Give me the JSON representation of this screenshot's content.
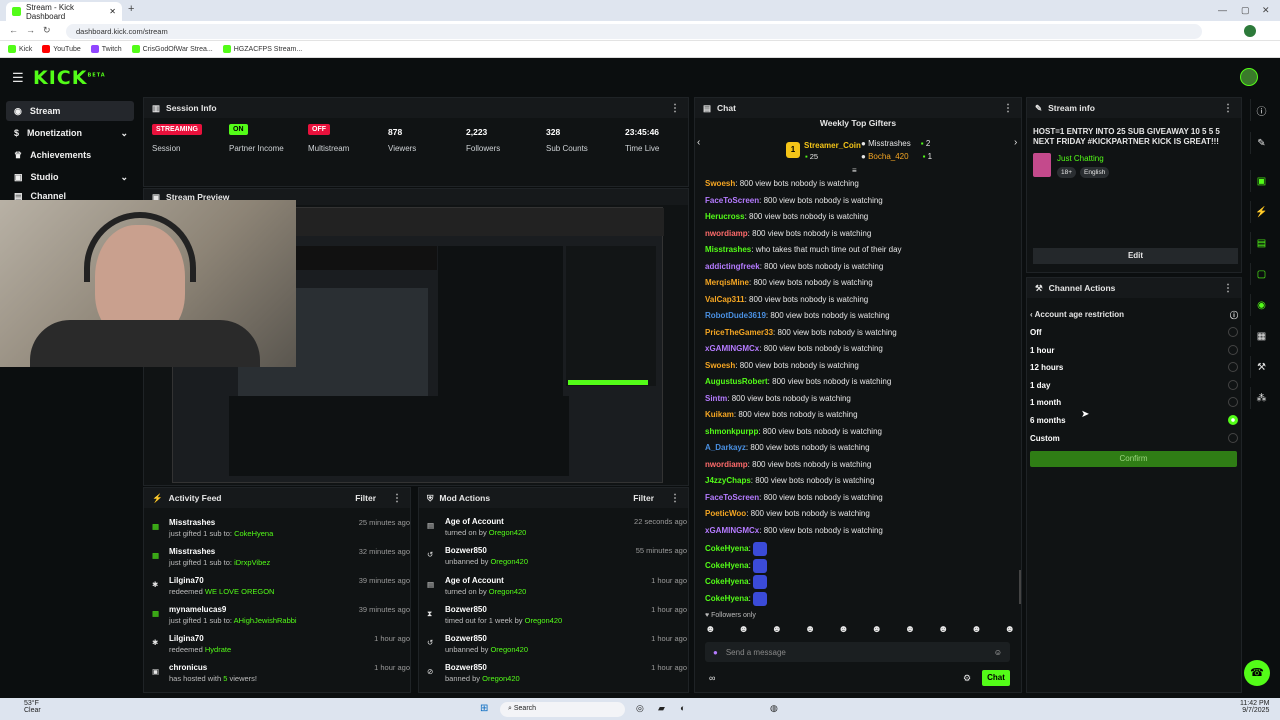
{
  "browser": {
    "tab_title": "Stream - Kick Dashboard",
    "url": "dashboard.kick.com/stream",
    "bookmarks": [
      "Kick",
      "YouTube",
      "Twitch",
      "CrisGodOfWar Strea...",
      "HGZACFPS Stream..."
    ]
  },
  "app": {
    "logo": "KICK",
    "beta": "BETA"
  },
  "sidebar": {
    "items": [
      {
        "label": "Stream",
        "icon": "signal-icon"
      },
      {
        "label": "Monetization",
        "icon": "dollar-icon"
      },
      {
        "label": "Achievements",
        "icon": "trophy-icon"
      },
      {
        "label": "Studio",
        "icon": "studio-icon"
      },
      {
        "label": "Channel",
        "icon": "channel-icon"
      }
    ]
  },
  "session": {
    "title": "Session Info",
    "stats": [
      {
        "badge": "STREAMING",
        "label": "Session"
      },
      {
        "badge": "ON",
        "label": "Partner Income"
      },
      {
        "badge": "OFF",
        "label": "Multistream"
      },
      {
        "value": "878",
        "label": "Viewers"
      },
      {
        "value": "2,223",
        "label": "Followers"
      },
      {
        "value": "328",
        "label": "Sub Counts"
      },
      {
        "value": "23:45:46",
        "label": "Time Live"
      }
    ]
  },
  "preview": {
    "title": "Stream Preview"
  },
  "activity": {
    "title": "Activity Feed",
    "filter": "Filter",
    "items": [
      {
        "name": "Misstrashes",
        "time": "25 minutes ago",
        "pre": "just gifted 1 sub to:",
        "hl": "CokeHyena"
      },
      {
        "name": "Misstrashes",
        "time": "32 minutes ago",
        "pre": "just gifted 1 sub to:",
        "hl": "iDrxpVibez"
      },
      {
        "name": "Lilgina70",
        "time": "39 minutes ago",
        "pre": "redeemed",
        "hl": "WE LOVE OREGON"
      },
      {
        "name": "mynamelucas9",
        "time": "39 minutes ago",
        "pre": "just gifted 1 sub to:",
        "hl": "AHighJewishRabbi"
      },
      {
        "name": "Lilgina70",
        "time": "1 hour ago",
        "pre": "redeemed",
        "hl": "Hydrate"
      },
      {
        "name": "chronicus",
        "time": "1 hour ago",
        "pre": "has hosted with",
        "hl": "5",
        "post": "viewers!"
      }
    ]
  },
  "modactions": {
    "title": "Mod Actions",
    "filter": "Filter",
    "items": [
      {
        "name": "Age of Account",
        "time": "22 seconds ago",
        "pre": "turned on by",
        "hl": "Oregon420"
      },
      {
        "name": "Bozwer850",
        "time": "55 minutes ago",
        "pre": "unbanned by",
        "hl": "Oregon420"
      },
      {
        "name": "Age of Account",
        "time": "1 hour ago",
        "pre": "turned on by",
        "hl": "Oregon420"
      },
      {
        "name": "Bozwer850",
        "time": "1 hour ago",
        "pre": "timed out for 1 week by",
        "hl": "Oregon420"
      },
      {
        "name": "Bozwer850",
        "time": "1 hour ago",
        "pre": "unbanned by",
        "hl": "Oregon420"
      },
      {
        "name": "Bozwer850",
        "time": "1 hour ago",
        "pre": "banned by",
        "hl": "Oregon420"
      }
    ]
  },
  "chat": {
    "title": "Chat",
    "gifters_title": "Weekly Top Gifters",
    "gifter1": {
      "name": "Streamer_Coin",
      "count": "25",
      "rank": "1"
    },
    "gifter2": {
      "name": "Misstrashes",
      "count": "2"
    },
    "gifter3": {
      "name": "Bocha_420",
      "count": "1"
    },
    "messages": [
      {
        "user": "Swoesh",
        "color": "#f5a623",
        "text": "800 view bots nobody is watching"
      },
      {
        "user": "FaceToScreen",
        "color": "#b57bff",
        "text": "800 view bots nobody is watching"
      },
      {
        "user": "Herucross",
        "color": "#53fc18",
        "text": "800 view bots nobody is watching"
      },
      {
        "user": "nwordiamp",
        "color": "#ff6b6b",
        "text": "800 view bots nobody is watching"
      },
      {
        "user": "Misstrashes",
        "color": "#53fc18",
        "text": "who takes that much time out of their day"
      },
      {
        "user": "addictingfreek",
        "color": "#b57bff",
        "text": "800 view bots nobody is watching"
      },
      {
        "user": "MerqisMine",
        "color": "#f5a623",
        "text": "800 view bots nobody is watching"
      },
      {
        "user": "ValCap311",
        "color": "#f5a623",
        "text": "800 view bots nobody is watching"
      },
      {
        "user": "RobotDude3619",
        "color": "#4a90e2",
        "text": "800 view bots nobody is watching"
      },
      {
        "user": "PriceTheGamer33",
        "color": "#f5a623",
        "text": "800 view bots nobody is watching"
      },
      {
        "user": "xGAMINGMCx",
        "color": "#b57bff",
        "text": "800 view bots nobody is watching"
      },
      {
        "user": "Swoesh",
        "color": "#f5a623",
        "text": "800 view bots nobody is watching"
      },
      {
        "user": "AugustusRobert",
        "color": "#53fc18",
        "text": "800 view bots nobody is watching"
      },
      {
        "user": "Sintm",
        "color": "#b57bff",
        "text": "800 view bots nobody is watching"
      },
      {
        "user": "Kuikam",
        "color": "#f5a623",
        "text": "800 view bots nobody is watching"
      },
      {
        "user": "shmonkpurpp",
        "color": "#53fc18",
        "text": "800 view bots nobody is watching"
      },
      {
        "user": "A_Darkayz",
        "color": "#4a90e2",
        "text": "800 view bots nobody is watching"
      },
      {
        "user": "nwordiamp",
        "color": "#ff6b6b",
        "text": "800 view bots nobody is watching"
      },
      {
        "user": "J4zzyChaps",
        "color": "#53fc18",
        "text": "800 view bots nobody is watching"
      },
      {
        "user": "FaceToScreen",
        "color": "#b57bff",
        "text": "800 view bots nobody is watching"
      },
      {
        "user": "PoeticWoo",
        "color": "#f5a623",
        "text": "800 view bots nobody is watching"
      },
      {
        "user": "xGAMINGMCx",
        "color": "#b57bff",
        "text": "800 view bots nobody is watching"
      },
      {
        "user": "CokeHyena",
        "color": "#53fc18",
        "text": ""
      },
      {
        "user": "CokeHyena",
        "color": "#53fc18",
        "text": ""
      },
      {
        "user": "CokeHyena",
        "color": "#53fc18",
        "text": ""
      },
      {
        "user": "CokeHyena",
        "color": "#53fc18",
        "text": ""
      }
    ],
    "followers_only": "Followers only",
    "placeholder": "Send a message",
    "send": "Chat"
  },
  "streaminfo": {
    "title": "Stream info",
    "stream_title": "HOST=1 ENTRY INTO 25 SUB GIVEAWAY 10 5 5 5 NEXT FRIDAY #KICKPARTNER KICK IS GREAT!!!",
    "category": "Just Chatting",
    "tags": [
      "18+",
      "English"
    ],
    "edit": "Edit"
  },
  "channelactions": {
    "title": "Channel Actions",
    "subtitle": "Account age restriction",
    "options": [
      {
        "label": "Off",
        "selected": false
      },
      {
        "label": "1 hour",
        "selected": false
      },
      {
        "label": "12 hours",
        "selected": false
      },
      {
        "label": "1 day",
        "selected": false
      },
      {
        "label": "1 month",
        "selected": false
      },
      {
        "label": "6 months",
        "selected": true
      },
      {
        "label": "Custom",
        "selected": false
      }
    ],
    "confirm": "Confirm"
  },
  "taskbar": {
    "weather_temp": "53°F",
    "weather_text": "Clear",
    "search": "Search",
    "time": "11:42 PM",
    "date": "9/7/2025"
  },
  "colors": {
    "accent": "#53fc18",
    "streaming": "#e9113c",
    "off": "#e9113c"
  }
}
